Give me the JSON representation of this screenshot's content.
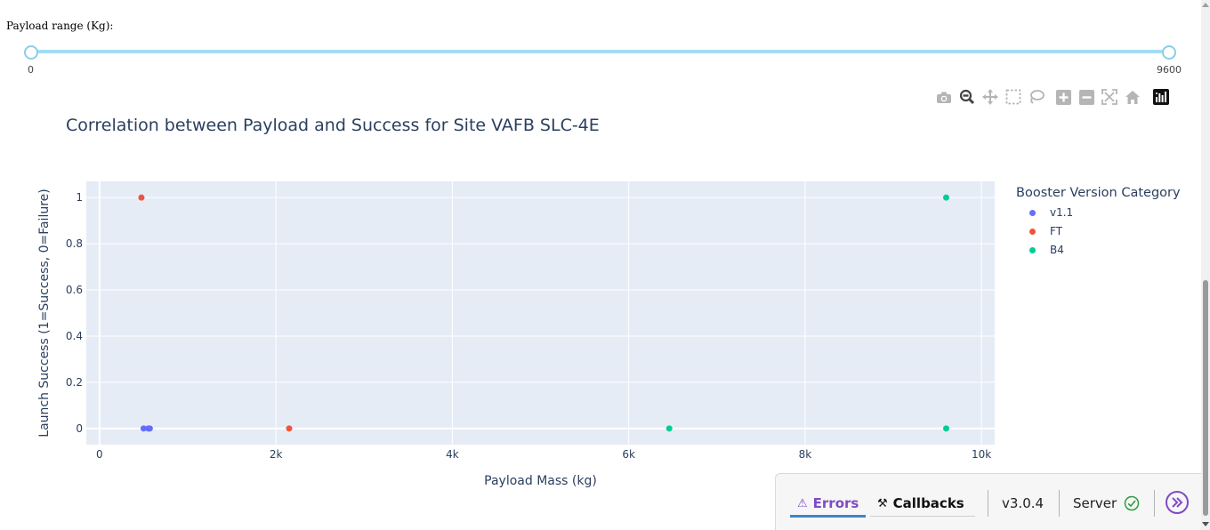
{
  "slider": {
    "label": "Payload range (Kg):",
    "min_label": "0",
    "max_label": "9600",
    "min": 0,
    "max": 9600,
    "value": [
      0,
      9600
    ]
  },
  "modebar": [
    {
      "name": "camera-icon",
      "title": "Download plot as a png"
    },
    {
      "name": "zoom-icon",
      "title": "Zoom"
    },
    {
      "name": "pan-icon",
      "title": "Pan"
    },
    {
      "name": "box-select-icon",
      "title": "Box Select"
    },
    {
      "name": "lasso-select-icon",
      "title": "Lasso Select"
    },
    {
      "name": "zoom-in-icon",
      "title": "Zoom in"
    },
    {
      "name": "zoom-out-icon",
      "title": "Zoom out"
    },
    {
      "name": "autoscale-icon",
      "title": "Autoscale"
    },
    {
      "name": "reset-axes-icon",
      "title": "Reset axes"
    },
    {
      "name": "plotly-logo-icon",
      "title": "Produced with Plotly"
    }
  ],
  "chart_data": {
    "type": "scatter",
    "title": "Correlation between Payload and Success for Site VAFB SLC-4E",
    "xlabel": "Payload Mass (kg)",
    "ylabel": "Launch Success (1=Success, 0=Failure)",
    "xlim": [
      -150,
      10150
    ],
    "ylim": [
      -0.07,
      1.07
    ],
    "x_ticks": [
      0,
      2000,
      4000,
      6000,
      8000,
      10000
    ],
    "x_tick_labels": [
      "0",
      "2k",
      "4k",
      "6k",
      "8k",
      "10k"
    ],
    "y_ticks": [
      0,
      0.2,
      0.4,
      0.6,
      0.8,
      1
    ],
    "y_tick_labels": [
      "0",
      "0.2",
      "0.4",
      "0.6",
      "0.8",
      "1"
    ],
    "grid": true,
    "legend_title": "Booster Version Category",
    "legend_position": "right",
    "series": [
      {
        "name": "v1.1",
        "color": "#636efa",
        "points": [
          [
            500,
            0
          ],
          [
            553,
            0
          ],
          [
            570,
            0
          ]
        ]
      },
      {
        "name": "FT",
        "color": "#ef553b",
        "points": [
          [
            475,
            1
          ],
          [
            2150,
            0
          ]
        ]
      },
      {
        "name": "B4",
        "color": "#00cc96",
        "points": [
          [
            9600,
            1
          ],
          [
            6460,
            0
          ],
          [
            9600,
            0
          ]
        ]
      }
    ],
    "plot_background": "#e5ecf6"
  },
  "debug_bar": {
    "errors_label": "Errors",
    "callbacks_label": "Callbacks",
    "version": "v3.0.4",
    "server_label": "Server",
    "accent_color": "#7f4bc4"
  }
}
